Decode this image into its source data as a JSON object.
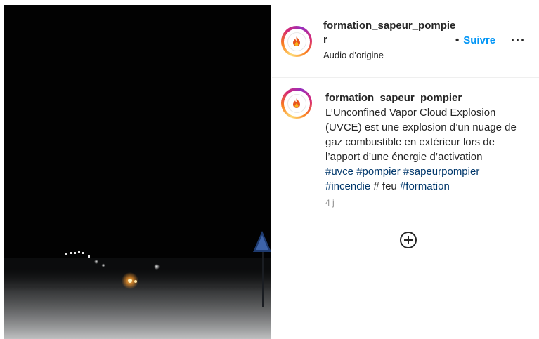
{
  "header": {
    "username": "formation_sapeur_pompier",
    "audio": "Audio d’origine",
    "follow_label": "Suivre",
    "dot": "•",
    "more": "···"
  },
  "caption": {
    "username": "formation_sapeur_pompier",
    "text": "L’Unconfined Vapor Cloud Explosion (UVCE) est une explosion d’un nuage de gaz combustible en extérieur lors de l’apport d’une énergie d’activation",
    "hashtags_1": [
      "#uvce",
      "#pompier",
      "#sapeurpompier"
    ],
    "hashtags_2": [
      "#incendie"
    ],
    "plain": "# feu",
    "hashtag_last": "#formation",
    "time": "4 j"
  },
  "video": {
    "sign_icon": "pedestrian-crossing-sign",
    "description_icon": "night-road-fog"
  },
  "icons": {
    "avatar": "fire-logo",
    "add": "add-circle-icon"
  },
  "colors": {
    "link": "#0095f6",
    "hashtag": "#00376b",
    "muted": "#8e8e8e"
  }
}
